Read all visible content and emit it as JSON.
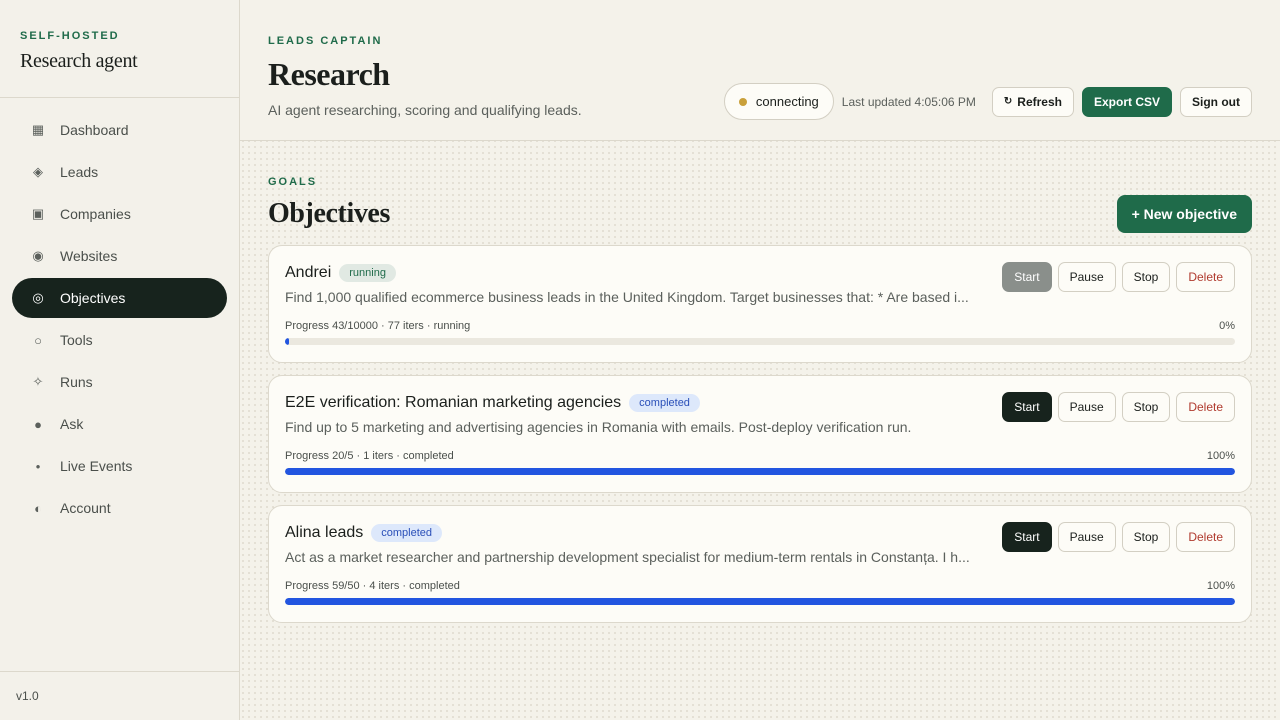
{
  "sidebar": {
    "kicker": "SELF-HOSTED",
    "title": "Research agent",
    "version": "v1.0",
    "items": [
      {
        "label": "Dashboard",
        "icon": "▦",
        "icon_name": "grid-icon"
      },
      {
        "label": "Leads",
        "icon": "◈",
        "icon_name": "diamond-icon"
      },
      {
        "label": "Companies",
        "icon": "▣",
        "icon_name": "building-icon"
      },
      {
        "label": "Websites",
        "icon": "◉",
        "icon_name": "globe-icon"
      },
      {
        "label": "Objectives",
        "icon": "◎",
        "icon_name": "target-icon"
      },
      {
        "label": "Tools",
        "icon": "○",
        "icon_name": "tool-icon"
      },
      {
        "label": "Runs",
        "icon": "✧",
        "icon_name": "sparkle-icon"
      },
      {
        "label": "Ask",
        "icon": "●",
        "icon_name": "chat-icon"
      },
      {
        "label": "Live Events",
        "icon": "•",
        "icon_name": "live-dot-icon"
      },
      {
        "label": "Account",
        "icon": "◐",
        "icon_name": "account-icon"
      }
    ],
    "active_index": 4
  },
  "header": {
    "kicker": "LEADS CAPTAIN",
    "title": "Research",
    "subtitle": "AI agent researching, scoring and qualifying leads.",
    "status": "connecting",
    "status_color": "#c9a03a",
    "last_updated": "Last updated 4:05:06 PM",
    "refresh_icon": "↻",
    "refresh_label": "Refresh",
    "export_label": "Export CSV",
    "signout_label": "Sign out"
  },
  "section": {
    "kicker": "GOALS",
    "title": "Objectives",
    "new_label": "+ New objective"
  },
  "actions": {
    "start": "Start",
    "pause": "Pause",
    "stop": "Stop",
    "delete": "Delete"
  },
  "objectives": [
    {
      "name": "Andrei",
      "status": "running",
      "description": "Find 1,000 qualified ecommerce business leads in the United Kingdom. Target businesses that: * Are based i...",
      "progress_text": "Progress 43/10000 · 77 iters · running",
      "percent_label": "0%",
      "progress": 0.0043,
      "start_disabled": true
    },
    {
      "name": "E2E verification: Romanian marketing agencies",
      "status": "completed",
      "description": "Find up to 5 marketing and advertising agencies in Romania with emails. Post-deploy verification run.",
      "progress_text": "Progress 20/5 · 1 iters · completed",
      "percent_label": "100%",
      "progress": 1,
      "start_disabled": false
    },
    {
      "name": "Alina leads",
      "status": "completed",
      "description": "Act as a market researcher and partnership development specialist for medium-term rentals in Constanța. I h...",
      "progress_text": "Progress 59/50 · 4 iters · completed",
      "percent_label": "100%",
      "progress": 1,
      "start_disabled": false
    }
  ],
  "colors": {
    "accent": "#1f6b4a",
    "progress": "#2255e0",
    "active_nav": "#17231d"
  }
}
